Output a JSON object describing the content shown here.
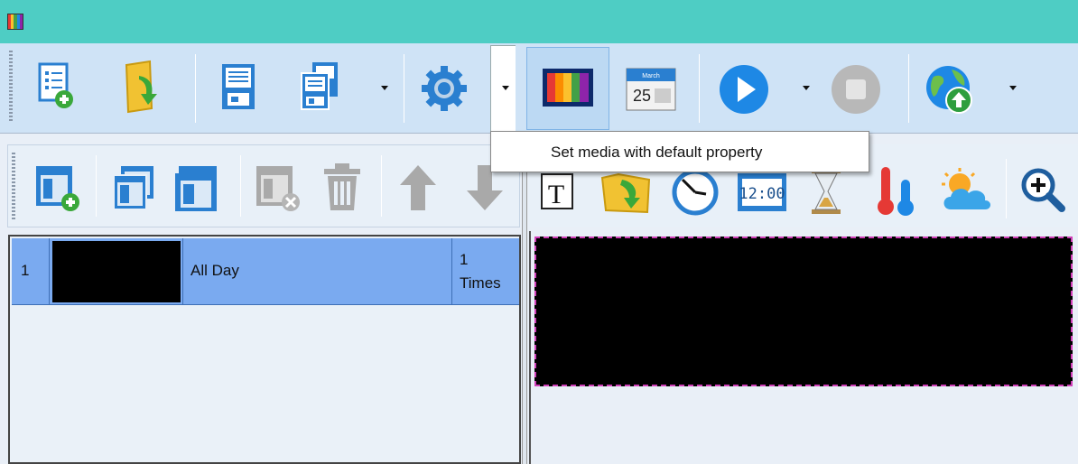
{
  "titlebar": {
    "app_icon": "rainbow-bars-icon"
  },
  "toolbar": {
    "buttons": [
      {
        "name": "new-program",
        "icon": "list-add-icon"
      },
      {
        "name": "open",
        "icon": "folder-open-icon"
      },
      {
        "name": "save",
        "icon": "floppy-save-icon"
      },
      {
        "name": "save-as",
        "icon": "floppy-save-as-icon"
      },
      {
        "name": "settings",
        "icon": "gear-icon"
      },
      {
        "name": "set-media",
        "icon": "rainbow-bars-icon"
      },
      {
        "name": "schedule",
        "icon": "calendar-icon",
        "month": "March",
        "day": "25"
      },
      {
        "name": "play",
        "icon": "play-icon"
      },
      {
        "name": "stop",
        "icon": "stop-icon"
      },
      {
        "name": "upload",
        "icon": "globe-upload-icon"
      }
    ]
  },
  "tooltip": {
    "text": "Set media with default property"
  },
  "program_toolbar": {
    "buttons": [
      "add-window-icon",
      "copy-window-icon",
      "paste-window-icon",
      "delete-window-icon",
      "trash-icon",
      "arrow-up-icon",
      "arrow-down-icon"
    ]
  },
  "media_toolbar": {
    "buttons": [
      "text-icon",
      "folder-media-icon",
      "clock-icon",
      "digital-clock-icon",
      "hourglass-icon",
      "thermometer-icon",
      "weather-icon",
      "zoom-in-icon"
    ],
    "digital_clock_text": "12:00"
  },
  "program_list": {
    "rows": [
      {
        "index": "1",
        "time": "All Day",
        "times_count": "1",
        "times_label": "Times"
      }
    ]
  },
  "colors": {
    "titlebar": "#4ecdc4",
    "toolbar": "#cfe3f6",
    "row_selected": "#7aaaf0",
    "screen_border": "#d03fb8"
  }
}
